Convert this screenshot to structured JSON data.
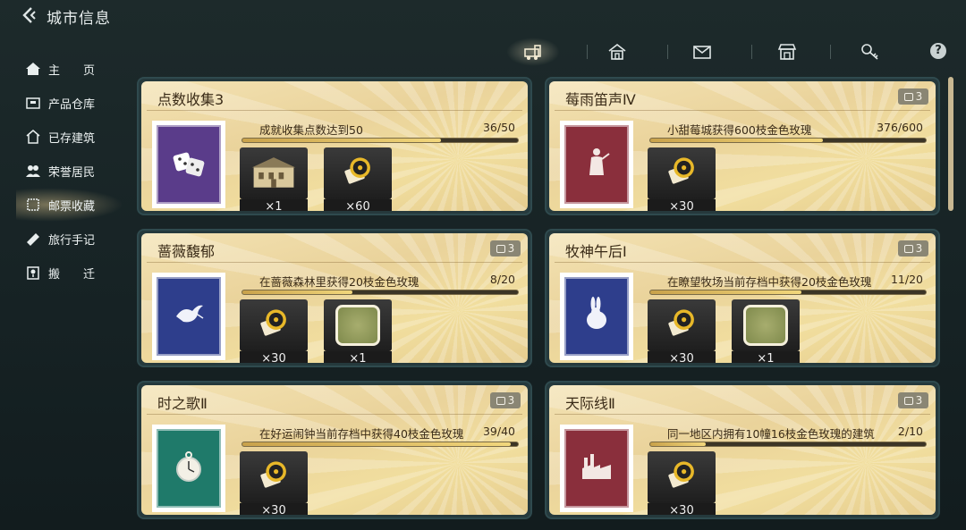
{
  "header": {
    "title": "城市信息"
  },
  "sidebar": {
    "items": [
      {
        "label": "主　　页",
        "icon": "home-icon"
      },
      {
        "label": "产品仓库",
        "icon": "warehouse-icon"
      },
      {
        "label": "已存建筑",
        "icon": "building-icon"
      },
      {
        "label": "荣誉居民",
        "icon": "residents-icon"
      },
      {
        "label": "邮票收藏",
        "icon": "stamp-icon",
        "active": true
      },
      {
        "label": "旅行手记",
        "icon": "book-icon"
      },
      {
        "label": "搬　　迁",
        "icon": "relocate-icon"
      }
    ]
  },
  "tabs": [
    {
      "icon": "train-icon",
      "active": true
    },
    {
      "icon": "house-icon"
    },
    {
      "icon": "mail-icon"
    },
    {
      "icon": "shop-icon"
    },
    {
      "icon": "key-icon"
    }
  ],
  "help": "?",
  "cards": [
    {
      "title": "点数收集3",
      "badge": "",
      "quest": "成就收集点数达到50",
      "progress_text": "36/50",
      "progress": 0.72,
      "stamp_color": "#5a3c8a",
      "stamp_icon": "dice-icon",
      "rewards": [
        {
          "icon": "building-reward-icon",
          "qty": "×1"
        },
        {
          "icon": "record-ticket-icon",
          "qty": "×60"
        }
      ]
    },
    {
      "title": "莓雨笛声Ⅳ",
      "badge": "3",
      "quest": "小甜莓城获得600枝金色玫瑰",
      "progress_text": "376/600",
      "progress": 0.627,
      "stamp_color": "#8a2f3c",
      "stamp_icon": "statue-icon",
      "rewards": [
        {
          "icon": "record-ticket-icon",
          "qty": "×30"
        }
      ]
    },
    {
      "title": "蔷薇馥郁",
      "badge": "3",
      "quest": "在蔷薇森林里获得20枝金色玫瑰",
      "progress_text": "8/20",
      "progress": 0.4,
      "stamp_color": "#2e3e8c",
      "stamp_icon": "dove-icon",
      "rewards": [
        {
          "icon": "record-ticket-icon",
          "qty": "×30"
        },
        {
          "icon": "land-tile-icon",
          "qty": "×1"
        }
      ]
    },
    {
      "title": "牧神午后Ⅰ",
      "badge": "3",
      "quest": "在瞭望牧场当前存档中获得20枝金色玫瑰",
      "progress_text": "11/20",
      "progress": 0.55,
      "stamp_color": "#2e3e8c",
      "stamp_icon": "rabbit-icon",
      "rewards": [
        {
          "icon": "record-ticket-icon",
          "qty": "×30"
        },
        {
          "icon": "land-tile-icon",
          "qty": "×1"
        }
      ]
    },
    {
      "title": "时之歌Ⅱ",
      "badge": "3",
      "quest": "在好运闹钟当前存档中获得40枝金色玫瑰",
      "progress_text": "39/40",
      "progress": 0.975,
      "stamp_color": "#1f7a6a",
      "stamp_icon": "pocket-watch-icon",
      "rewards": [
        {
          "icon": "record-ticket-icon",
          "qty": "×30"
        }
      ]
    },
    {
      "title": "天际线Ⅱ",
      "badge": "3",
      "quest": "同一地区内拥有10幢16枝金色玫瑰的建筑",
      "progress_text": "2/10",
      "progress": 0.2,
      "stamp_color": "#8a2f3c",
      "stamp_icon": "factory-icon",
      "rewards": [
        {
          "icon": "record-ticket-icon",
          "qty": "×30"
        }
      ]
    }
  ]
}
